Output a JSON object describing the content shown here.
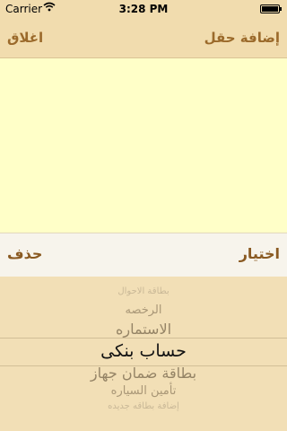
{
  "status_bar": {
    "carrier": "Carrier",
    "wifi_icon": "wifi-icon",
    "time": "3:28 PM",
    "battery_icon": "battery-icon"
  },
  "nav": {
    "left_button": "اغلاق",
    "right_button": "إضافة حقل"
  },
  "text_area": {
    "value": ""
  },
  "toolbar": {
    "left_button": "حذف",
    "right_button": "اختيار"
  },
  "picker": {
    "items": [
      "بطاقة الاحوال",
      "الرخصه",
      "الاستماره",
      "حساب بنكى",
      "بطاقة ضمان جهاز",
      "تأمين السياره",
      "إضافة بطاقه جديده"
    ],
    "selected": "حساب بنكى"
  },
  "colors": {
    "background": "#f2dfb6",
    "text_area": "#ffffc8",
    "accent": "#9b6a2b"
  }
}
